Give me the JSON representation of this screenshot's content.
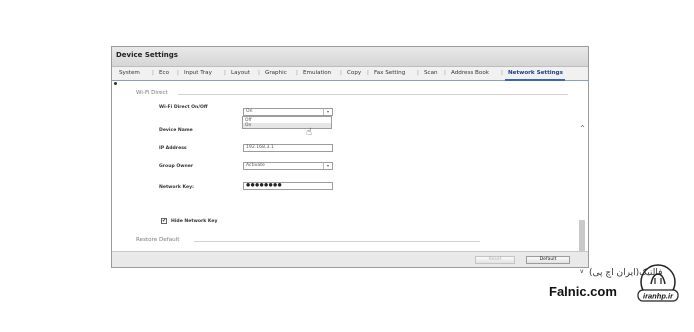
{
  "window": {
    "title": "Device Settings"
  },
  "tabs": [
    {
      "label": "System"
    },
    {
      "label": "Eco"
    },
    {
      "label": "Input Tray"
    },
    {
      "label": "Layout"
    },
    {
      "label": "Graphic"
    },
    {
      "label": "Emulation"
    },
    {
      "label": "Copy"
    },
    {
      "label": "Fax Setting"
    },
    {
      "label": "Scan"
    },
    {
      "label": "Address Book"
    },
    {
      "label": "Network Settings",
      "active": true
    }
  ],
  "wifi_direct": {
    "section_label": "Wi-Fi Direct",
    "onoff": {
      "label": "Wi-Fi Direct On/Off",
      "value": "On",
      "options": [
        "Off",
        "On"
      ],
      "highlighted": "On"
    },
    "device_name": {
      "label": "Device Name",
      "value": ""
    },
    "ip_address": {
      "label": "IP Address",
      "value": "192.168.3.1"
    },
    "group_owner": {
      "label": "Group Owner",
      "value": "Activate"
    },
    "network_key": {
      "label": "Network Key:",
      "value": "●●●●●●●●"
    },
    "hide_key": {
      "label": "Hide Network Key",
      "checked": true,
      "mark": "✔"
    }
  },
  "restore": {
    "section_label": "Restore Default"
  },
  "footer": {
    "reset_label": "Reset",
    "default_label": "Default"
  },
  "watermark": {
    "fa_text": "فالنیک(ایران اچ پی)",
    "en_text": "Falnic.com",
    "logo_text": "iranhp.ir"
  },
  "icons": {
    "dropdown": "▾",
    "scroll_up": "^",
    "scroll_down": "v",
    "cursor": "☝"
  },
  "colors": {
    "active_tab": "#1a3f8a",
    "accent_underline": "#3b66b0"
  }
}
